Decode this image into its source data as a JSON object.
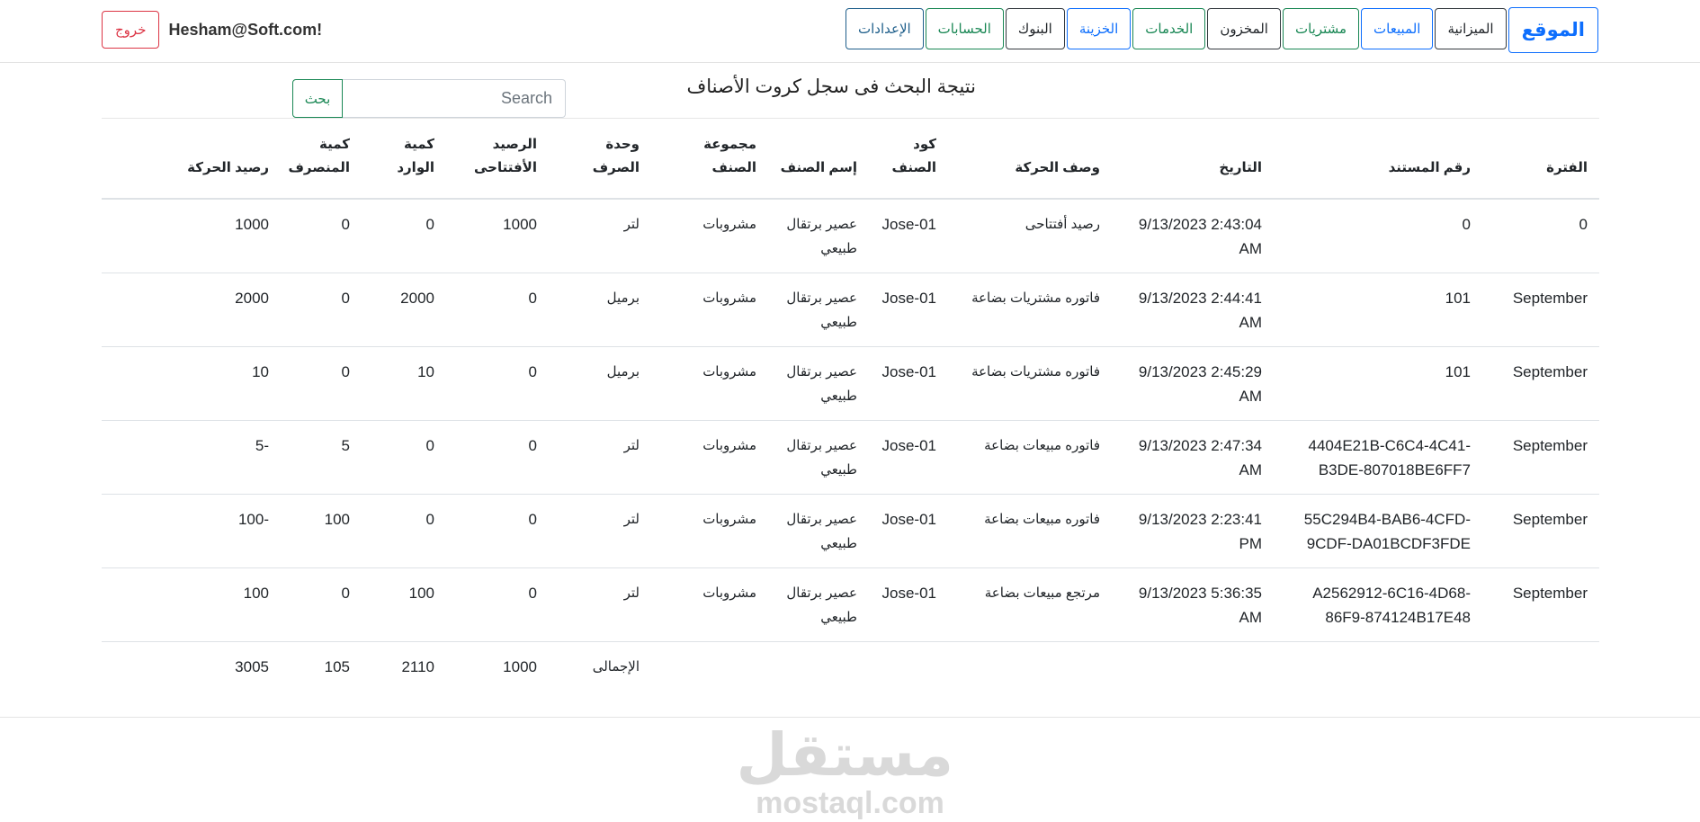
{
  "nav": {
    "brand": "الموقع",
    "items": [
      {
        "label": "الميزانية",
        "color": "dark"
      },
      {
        "label": "المبيعات",
        "color": "blue"
      },
      {
        "label": "مشتريات",
        "color": "green"
      },
      {
        "label": "المخزون",
        "color": "dark"
      },
      {
        "label": "الخدمات",
        "color": "green"
      },
      {
        "label": "الخزينة",
        "color": "blue"
      },
      {
        "label": "البنوك",
        "color": "dark"
      },
      {
        "label": "الحسابات",
        "color": "green"
      },
      {
        "label": "الإعدادات",
        "color": "teal"
      }
    ],
    "user_email": "Hesham@Soft.com!",
    "logout_label": "خروج"
  },
  "page": {
    "title": "نتيجة البحث فى سجل كروت الأصناف",
    "search_placeholder": "Search",
    "search_button": "بحث"
  },
  "table": {
    "headers": {
      "period": "الفترة",
      "doc_no": "رقم المستند",
      "date": "التاريخ",
      "movement": "وصف الحركة",
      "item_code": "كود الصنف",
      "item_name": "إسم الصنف",
      "item_group": "مجموعة الصنف",
      "unit": "وحدة الصرف",
      "opening": "الرصيد الأفتتاحى",
      "qty_in": "كمية الوارد",
      "qty_out": "كمية المنصرف",
      "balance": "رصيد الحركة"
    },
    "rows": [
      {
        "period": "0",
        "doc_no": "0",
        "date": "9/13/2023 2:43:04 AM",
        "movement": "رصيد أفتتاحى",
        "item_code": "Jose-01",
        "item_name": "عصير برتقال طبيعي",
        "item_group": "مشروبات",
        "unit": "لتر",
        "opening": "1000",
        "qty_in": "0",
        "qty_out": "0",
        "balance": "1000"
      },
      {
        "period": "September",
        "doc_no": "101",
        "date": "9/13/2023 2:44:41 AM",
        "movement": "فاتوره مشتريات بضاعة",
        "item_code": "Jose-01",
        "item_name": "عصير برتقال طبيعي",
        "item_group": "مشروبات",
        "unit": "برميل",
        "opening": "0",
        "qty_in": "2000",
        "qty_out": "0",
        "balance": "2000"
      },
      {
        "period": "September",
        "doc_no": "101",
        "date": "9/13/2023 2:45:29 AM",
        "movement": "فاتوره مشتريات بضاعة",
        "item_code": "Jose-01",
        "item_name": "عصير برتقال طبيعي",
        "item_group": "مشروبات",
        "unit": "برميل",
        "opening": "0",
        "qty_in": "10",
        "qty_out": "0",
        "balance": "10"
      },
      {
        "period": "September",
        "doc_no": "4404E21B-C6C4-4C41-B3DE-807018BE6FF7",
        "date": "9/13/2023 2:47:34 AM",
        "movement": "فاتوره مبيعات بضاعة",
        "item_code": "Jose-01",
        "item_name": "عصير برتقال طبيعي",
        "item_group": "مشروبات",
        "unit": "لتر",
        "opening": "0",
        "qty_in": "0",
        "qty_out": "5",
        "balance": "-5"
      },
      {
        "period": "September",
        "doc_no": "55C294B4-BAB6-4CFD-9CDF-DA01BCDF3FDE",
        "date": "9/13/2023 2:23:41 PM",
        "movement": "فاتوره مبيعات بضاعة",
        "item_code": "Jose-01",
        "item_name": "عصير برتقال طبيعي",
        "item_group": "مشروبات",
        "unit": "لتر",
        "opening": "0",
        "qty_in": "0",
        "qty_out": "100",
        "balance": "-100"
      },
      {
        "period": "September",
        "doc_no": "A2562912-6C16-4D68-86F9-874124B17E48",
        "date": "9/13/2023 5:36:35 AM",
        "movement": "مرتجع مبيعات بضاعة",
        "item_code": "Jose-01",
        "item_name": "عصير برتقال طبيعي",
        "item_group": "مشروبات",
        "unit": "لتر",
        "opening": "0",
        "qty_in": "100",
        "qty_out": "0",
        "balance": "100"
      }
    ],
    "totals": {
      "label": "الإجمالى",
      "opening": "1000",
      "qty_in": "2110",
      "qty_out": "105",
      "balance": "3005"
    }
  },
  "watermark": {
    "arabic": "مستقل",
    "latin": "mostaql.com"
  }
}
